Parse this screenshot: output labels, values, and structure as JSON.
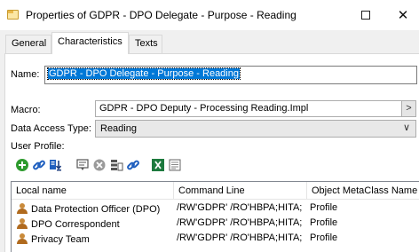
{
  "window": {
    "title": "Properties of GDPR - DPO Delegate - Purpose - Reading",
    "maximize_icon": "maximize-icon",
    "close_icon": "close-icon"
  },
  "tabs": [
    {
      "label": "General",
      "active": false
    },
    {
      "label": "Characteristics",
      "active": true
    },
    {
      "label": "Texts",
      "active": false
    }
  ],
  "form": {
    "name_label": "Name:",
    "name_value": "GDPR - DPO Delegate - Purpose - Reading",
    "macro_label": "Macro:",
    "macro_value": "GDPR - DPO Deputy - Processing Reading.Impl",
    "macro_button": ">",
    "data_access_label": "Data Access Type:",
    "data_access_value": "Reading",
    "user_profile_label": "User Profile:"
  },
  "toolbar": {
    "icons": [
      "add-icon",
      "link-icon",
      "export-icon",
      "properties-icon",
      "remove-icon",
      "list-icon",
      "unlink-icon",
      "excel-icon",
      "report-icon"
    ]
  },
  "table": {
    "columns": [
      "Local name",
      "Command Line",
      "Object MetaClass Name"
    ],
    "rows": [
      {
        "name": "Data Protection Officer (DPO)",
        "command": "/RW'GDPR' /RO'HBPA;HITA;",
        "metaclass": "Profile"
      },
      {
        "name": "DPO Correspondent",
        "command": "/RW'GDPR' /RO'HBPA;HITA;",
        "metaclass": "Profile"
      },
      {
        "name": "Privacy Team",
        "command": "/RW'GDPR' /RO'HBPA;HITA;",
        "metaclass": "Profile"
      }
    ]
  },
  "colors": {
    "selection": "#0078d7",
    "green": "#2e9b2e",
    "blue": "#1f5fbf"
  }
}
